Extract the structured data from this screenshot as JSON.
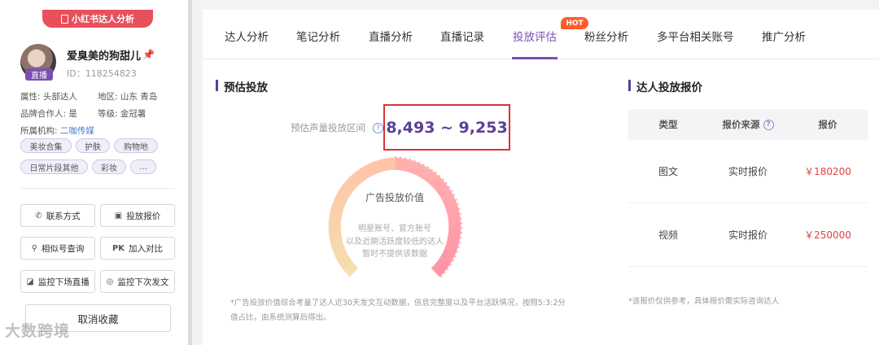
{
  "sidebar": {
    "banner": "小红书达人分析",
    "live_badge": "直播",
    "name": "爱臭美的狗甜儿",
    "id": "ID：118254823",
    "attribute_label": "属性:",
    "attribute_value": "头部达人",
    "region_label": "地区:",
    "region_value": "山东 青岛",
    "brand_label": "品牌合作人:",
    "brand_value": "是",
    "level_label": "等级:",
    "level_value": "金冠薯",
    "org_label": "所属机构:",
    "org_value": "二咖传媒",
    "tags": [
      "美妆合集",
      "护肤",
      "购物地",
      "日常片段其他",
      "彩妆",
      "..."
    ],
    "buttons": [
      "联系方式",
      "投放报价",
      "相似号查询",
      "加入对比",
      "监控下场直播",
      "监控下次发文"
    ],
    "cancel_label": "取消收藏"
  },
  "tabs": [
    "达人分析",
    "笔记分析",
    "直播分析",
    "直播记录",
    "投放评估",
    "粉丝分析",
    "多平台相关账号",
    "推广分析"
  ],
  "active_tab": "投放评估",
  "hot_badge": "HOT",
  "estimate": {
    "title": "预估投放",
    "range_label": "预估声量投放区间",
    "range_value": "8,493 ~ 9,253",
    "gauge_title": "广告投放价值",
    "gauge_note_1": "明星账号、官方账号",
    "gauge_note_2": "以及近期活跃度较低的达人",
    "gauge_note_3": "暂时不提供该数据",
    "footnote": "*广告投放价值综合考量了达人近30天发文互动数据，信息完整度以及平台活跃情况，按照5:3:2分值占比，由系统测算后得出。"
  },
  "pricing": {
    "title": "达人投放报价",
    "headers": [
      "类型",
      "报价来源",
      "报价"
    ],
    "rows": [
      {
        "type": "图文",
        "source": "实时报价",
        "price": "￥180200"
      },
      {
        "type": "视频",
        "source": "实时报价",
        "price": "￥250000"
      }
    ],
    "note": "*该报价仅供参考，具体报价需实际咨询达人"
  },
  "watermark": "大数跨境",
  "colors": {
    "accent": "#7b4fb0",
    "banner": "#e8505b",
    "highlight_border": "#d9343b",
    "price": "#e0413f",
    "gauge_left": "#f4dfae",
    "gauge_right": "#ff94a8"
  }
}
